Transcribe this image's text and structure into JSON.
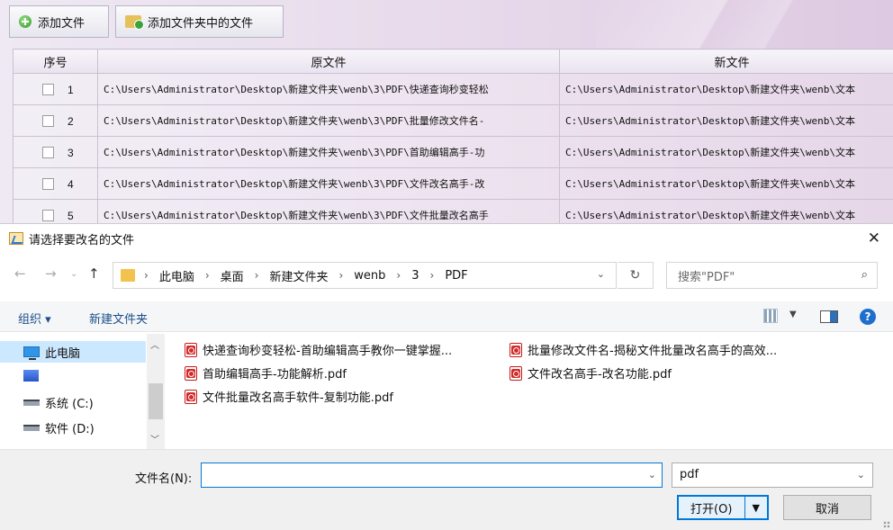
{
  "app": {
    "add_file": "添加文件",
    "add_folder_files": "添加文件夹中的文件",
    "columns": [
      "序号",
      "原文件",
      "新文件"
    ],
    "rows": [
      {
        "no": "1",
        "orig": "C:\\Users\\Administrator\\Desktop\\新建文件夹\\wenb\\3\\PDF\\快递查询秒变轻松",
        "new": "C:\\Users\\Administrator\\Desktop\\新建文件夹\\wenb\\文本"
      },
      {
        "no": "2",
        "orig": "C:\\Users\\Administrator\\Desktop\\新建文件夹\\wenb\\3\\PDF\\批量修改文件名-",
        "new": "C:\\Users\\Administrator\\Desktop\\新建文件夹\\wenb\\文本"
      },
      {
        "no": "3",
        "orig": "C:\\Users\\Administrator\\Desktop\\新建文件夹\\wenb\\3\\PDF\\首助编辑高手-功",
        "new": "C:\\Users\\Administrator\\Desktop\\新建文件夹\\wenb\\文本"
      },
      {
        "no": "4",
        "orig": "C:\\Users\\Administrator\\Desktop\\新建文件夹\\wenb\\3\\PDF\\文件改名高手-改",
        "new": "C:\\Users\\Administrator\\Desktop\\新建文件夹\\wenb\\文本"
      },
      {
        "no": "5",
        "orig": "C:\\Users\\Administrator\\Desktop\\新建文件夹\\wenb\\3\\PDF\\文件批量改名高手",
        "new": "C:\\Users\\Administrator\\Desktop\\新建文件夹\\wenb\\文本"
      }
    ]
  },
  "dialog": {
    "title": "请选择要改名的文件",
    "close": "✕",
    "breadcrumb": [
      "此电脑",
      "桌面",
      "新建文件夹",
      "wenb",
      "3",
      "PDF"
    ],
    "search_placeholder": "搜索\"PDF\"",
    "organize": "组织 ▾",
    "new_folder": "新建文件夹",
    "help": "?",
    "nav": [
      {
        "label": "此电脑",
        "icon": "computer-icon"
      },
      {
        "label": "",
        "icon": "app-icon"
      },
      {
        "label": "系统 (C:)",
        "icon": "drive-icon"
      },
      {
        "label": "软件 (D:)",
        "icon": "drive-icon"
      }
    ],
    "files": [
      "快递查询秒变轻松-首助编辑高手教你一键掌握...",
      "批量修改文件名-揭秘文件批量改名高手的高效...",
      "首助编辑高手-功能解析.pdf",
      "文件改名高手-改名功能.pdf",
      "文件批量改名高手软件-复制功能.pdf"
    ],
    "filename_label": "文件名(N):",
    "filename_value": "",
    "filetype": "pdf",
    "open": "打开(O)",
    "cancel": "取消"
  }
}
